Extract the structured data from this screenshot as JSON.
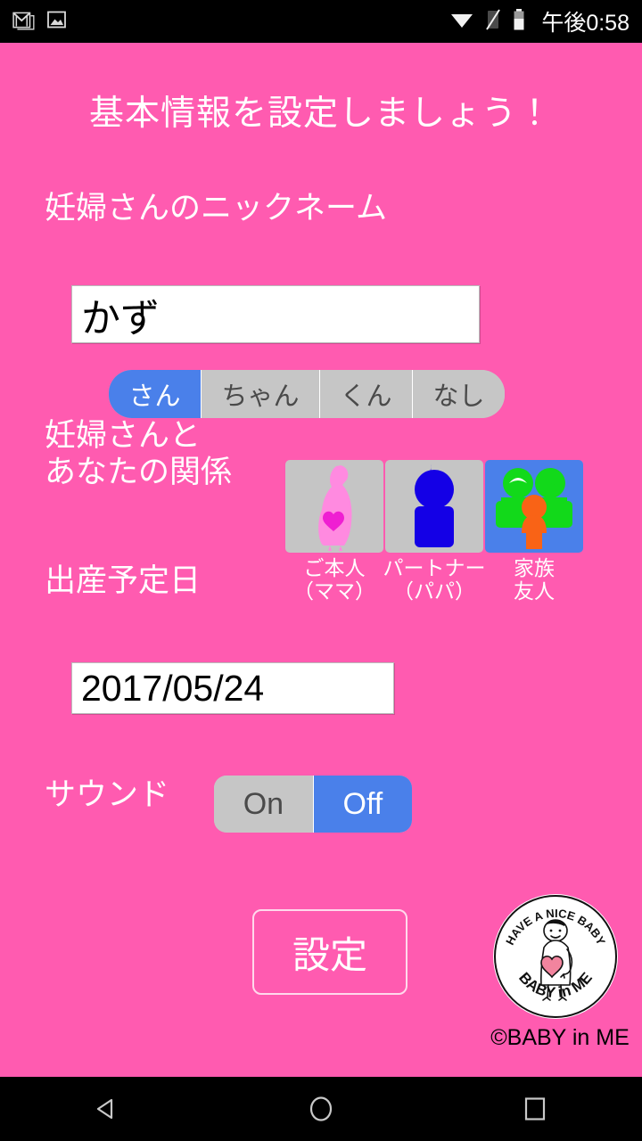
{
  "statusbar": {
    "time": "午後0:58",
    "left_icons": [
      "gmail-icon",
      "photo-icon"
    ],
    "right_icons": [
      "wifi-icon",
      "no-signal-icon",
      "battery-icon"
    ]
  },
  "screen": {
    "background_color": "#ff5bb0",
    "title": "基本情報を設定しましょう！"
  },
  "nickname": {
    "label": "妊婦さんのニックネーム",
    "value": "かず",
    "placeholder": ""
  },
  "honorific": {
    "options": [
      "さん",
      "ちゃん",
      "くん",
      "なし"
    ],
    "selected_index": 0,
    "selected_color": "#4a80ea",
    "unselected_color": "#c6c6c6"
  },
  "relationship": {
    "label": "妊婦さんと\nあなたの関係",
    "options": [
      {
        "caption": "ご本人\n（ママ）",
        "icon": "pregnant-woman-icon"
      },
      {
        "caption": "パートナー\n（パパ）",
        "icon": "partner-person-icon"
      },
      {
        "caption": "家族\n友人",
        "icon": "family-group-icon"
      }
    ],
    "selected_index": 2
  },
  "duedate": {
    "label": "出産予定日",
    "value": "2017/05/24"
  },
  "sound": {
    "label": "サウンド",
    "options": [
      "On",
      "Off"
    ],
    "selected_index": 1
  },
  "submit": {
    "label": "設定"
  },
  "logo": {
    "top_arc_text": "HAVE A NICE BABY",
    "bottom_arc_text": "BABY in ME",
    "caption": "©BABY in ME"
  },
  "navbar": {
    "back": "back-icon",
    "home": "home-icon",
    "recents": "recents-icon"
  }
}
